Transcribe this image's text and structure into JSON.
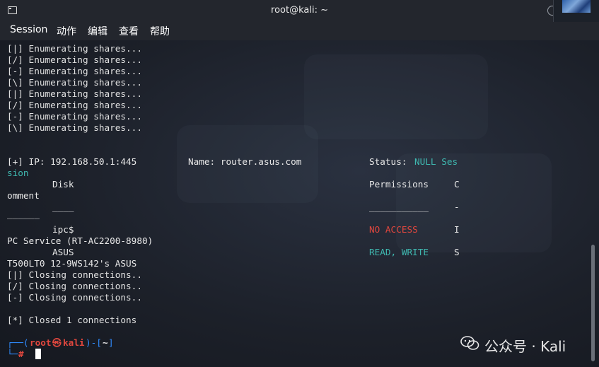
{
  "window": {
    "title": "root@kali: ~"
  },
  "menu": {
    "items": [
      "Session",
      "动作",
      "编辑",
      "查看",
      "帮助"
    ]
  },
  "terminal": {
    "enum_lines": [
      "[|] Enumerating shares...",
      "[/] Enumerating shares...",
      "[-] Enumerating shares...",
      "[\\] Enumerating shares...",
      "[|] Enumerating shares...",
      "[/] Enumerating shares...",
      "[-] Enumerating shares...",
      "[\\] Enumerating shares..."
    ],
    "result": {
      "ip": "[+] IP: 192.168.50.1:445",
      "name": "Name: router.asus.com",
      "status_label": "Status: ",
      "status_value": "NULL Ses",
      "status_wrap": "sion"
    },
    "header": {
      "disk": "Disk",
      "permissions": "Permissions",
      "comment_c": "C",
      "comment_wrap": "omment",
      "disk_rule": "____",
      "perm_rule": "___________",
      "comment_rule": "-",
      "comment_rule_wrap": "______"
    },
    "shares": [
      {
        "disk": "ipc$",
        "permission": "NO ACCESS",
        "comment_c": "I",
        "comment_wrap": "PC Service (RT-AC2200-8980)"
      },
      {
        "disk": "ASUS",
        "permission": "READ, WRITE",
        "comment_c": "S",
        "comment_wrap": "T500LT0 12-9WS142's ASUS"
      }
    ],
    "closing_lines": [
      "[|] Closing connections..",
      "[/] Closing connections..",
      "[-] Closing connections.."
    ],
    "closed": "[*] Closed 1 connections",
    "prompt": {
      "top_left": "┌──(",
      "user": "root",
      "at": "㉿",
      "host": "kali",
      "mid": ")-[",
      "dir": "~",
      "end": "]",
      "bottom": "└─",
      "hash": "#"
    }
  },
  "watermark": {
    "text": "公众号 · Kali"
  },
  "colors": {
    "teal": "#3fb8b0",
    "red": "#e0473e",
    "prompt_blue": "#2f8cff"
  }
}
